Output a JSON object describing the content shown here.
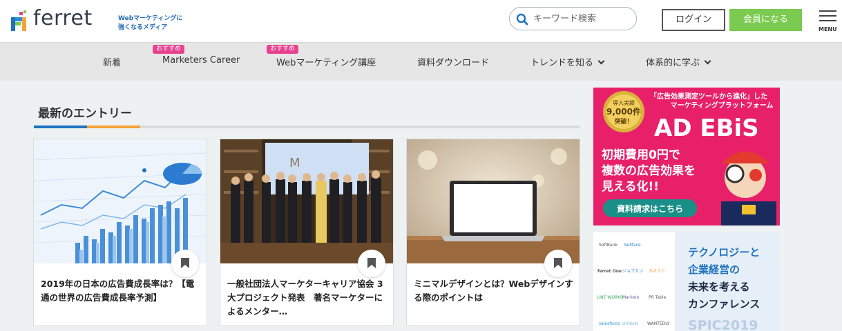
{
  "header": {
    "logo_text": "ferret",
    "tagline_line1": "Webマーケティングに",
    "tagline_line2": "強くなるメディア",
    "search_placeholder": "キーワード検索",
    "login_label": "ログイン",
    "member_label": "会員になる",
    "menu_label": "MENU"
  },
  "nav": {
    "items": [
      {
        "label": "新着",
        "badge": ""
      },
      {
        "label": "Marketers Career",
        "badge": "おすすめ"
      },
      {
        "label": "Webマーケティング講座",
        "badge": "おすすめ"
      },
      {
        "label": "資料ダウンロード",
        "badge": ""
      },
      {
        "label": "トレンドを知る",
        "badge": ""
      },
      {
        "label": "体系的に学ぶ",
        "badge": ""
      }
    ]
  },
  "section": {
    "title": "最新のエントリー"
  },
  "cards": [
    {
      "title": "2019年の日本の広告費成長率は？【電通の世界の広告費成長率予測】"
    },
    {
      "title": "一般社団法人マーケターキャリア協会 3大プロジェクト発表　著名マーケターによるメンター…"
    },
    {
      "title": "ミニマルデザインとは？Webデザインする際のポイントは"
    }
  ],
  "ad1": {
    "headline_line1": "「広告効果測定ツールから進化」した",
    "headline_line2": "マーケティングプラットフォーム",
    "badge_line1": "導入実績",
    "badge_line2": "9,000件",
    "badge_line3": "突破！",
    "brand": "AD EBiS",
    "copy_line1": "初期費用0円で",
    "copy_line2": "複数の広告効果を",
    "copy_line3": "見える化!!",
    "cta": "資料請求はこちら"
  },
  "ad2": {
    "line1": "テクノロジーと",
    "line2": "企業経営の",
    "line3": "未来を考える",
    "line4": "カンファレンス",
    "event": "SPIC2019",
    "sponsors": [
      "SoftBank",
      "bellface",
      "",
      "ferret One",
      "ジョブカン",
      "カオナビ",
      "LINE WORKS",
      "Marketo",
      "PR Table",
      "salesforce",
      "Umbots",
      "WANTEDLY"
    ]
  },
  "colors": {
    "brand_blue": "#1e73be",
    "accent_orange": "#f5a33b",
    "member_green": "#7acb4f",
    "badge_pink": "#e8418f",
    "ad_pink": "#e91e63"
  }
}
